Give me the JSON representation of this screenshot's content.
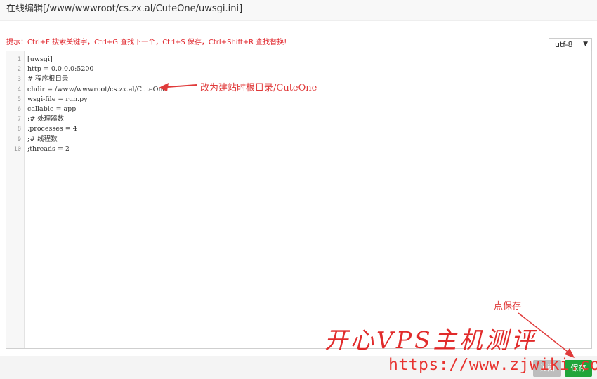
{
  "window": {
    "title": "在线编辑[/www/wwwroot/cs.zx.al/CuteOne/uwsgi.ini]"
  },
  "tip": "提示：Ctrl+F 搜索关键字，Ctrl+G 查找下一个，Ctrl+S 保存，Ctrl+Shift+R 查找替换!",
  "encoding": {
    "selected": "utf-8"
  },
  "editor": {
    "line_numbers": [
      "1",
      "2",
      "3",
      "4",
      "5",
      "6",
      "7",
      "8",
      "9",
      "10"
    ],
    "lines": [
      "[uwsgi]",
      "http = 0.0.0.0:5200",
      "# 程序根目录",
      "chdir = /www/wwwroot/cs.zx.al/CuteOne",
      "wsgi-file = run.py",
      "callable = app",
      ";# 处理器数",
      ";processes = 4",
      ";# 线程数",
      ";threads = 2"
    ]
  },
  "annotations": {
    "chdir_note": "改为建站时根目录/CuteOne",
    "save_note": "点保存",
    "color": "#e03a3a"
  },
  "footer": {
    "close_label": "关闭",
    "save_label": "保存"
  },
  "watermark": {
    "text_cn": "开心VPS主机测评",
    "url": "https://www.zjwiki.com"
  },
  "colors": {
    "save_button": "#20a53a",
    "close_button": "#bdbdbd",
    "tip": "#e0262c"
  }
}
